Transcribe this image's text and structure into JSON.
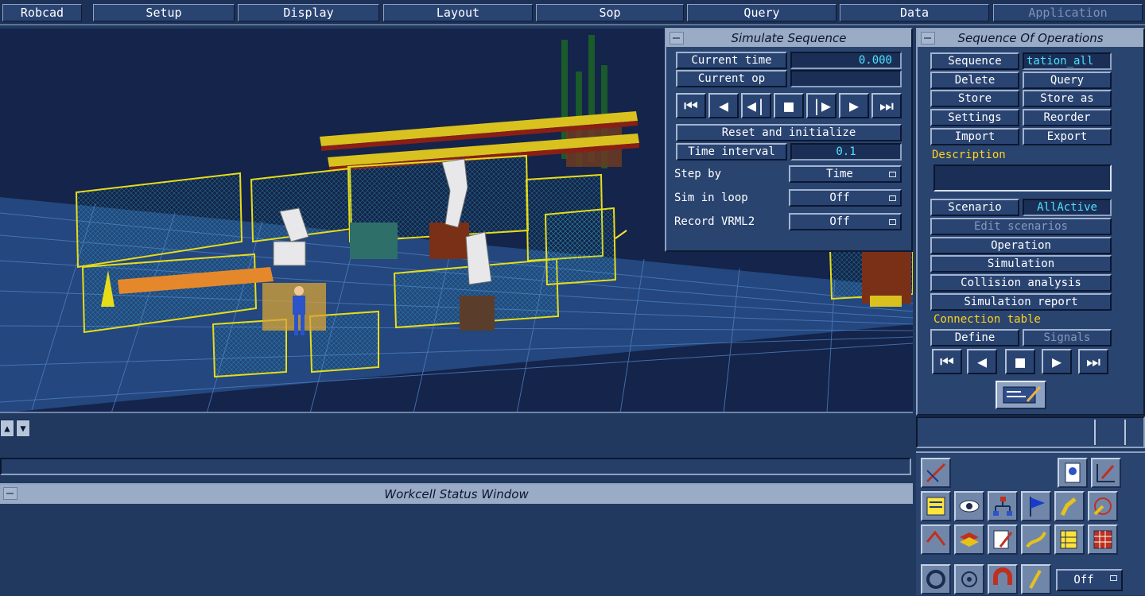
{
  "menu": {
    "robcad": "Robcad",
    "setup": "Setup",
    "display": "Display",
    "layout": "Layout",
    "sop": "Sop",
    "query": "Query",
    "data": "Data",
    "application": "Application"
  },
  "simulate": {
    "title": "Simulate Sequence",
    "current_time_label": "Current time",
    "current_time_value": "0.000",
    "current_op_label": "Current op",
    "current_op_value": "",
    "controls": [
      "⏮",
      "◀",
      "◀|",
      "■",
      "|▶",
      "▶",
      "⏭"
    ],
    "reset_label": "Reset and initialize",
    "time_interval_label": "Time interval",
    "time_interval_value": "0.1",
    "step_by_label": "Step by",
    "step_by_value": "Time",
    "sim_in_loop_label": "Sim in loop",
    "sim_in_loop_value": "Off",
    "record_vrml_label": "Record VRML2",
    "record_vrml_value": "Off"
  },
  "sop": {
    "title": "Sequence Of Operations",
    "sequence_label": "Sequence",
    "sequence_value": "tation_all",
    "delete": "Delete",
    "query": "Query",
    "store": "Store",
    "store_as": "Store as",
    "settings": "Settings",
    "reorder": "Reorder",
    "import": "Import",
    "export": "Export",
    "description_label": "Description",
    "description_value": "",
    "scenario_label": "Scenario",
    "scenario_value": "AllActive",
    "edit_scenarios": "Edit scenarios",
    "operation": "Operation",
    "simulation": "Simulation",
    "collision_analysis": "Collision analysis",
    "simulation_report": "Simulation report",
    "connection_table_label": "Connection table",
    "define": "Define",
    "signals": "Signals",
    "controls": [
      "⏮",
      "◀",
      "■",
      "▶",
      "⏭"
    ]
  },
  "status": {
    "title": "Workcell Status Window"
  },
  "toolbox": {
    "off_label": "Off",
    "icons": [
      "robot-pen-icon",
      "document-icon",
      "grid-pen-icon",
      "list-icon",
      "eye-icon",
      "hierarchy-icon",
      "flag-icon",
      "robot-arm-icon",
      "target-arm-icon",
      "path-icon",
      "layers-icon",
      "chart-pen-icon",
      "paint-icon",
      "table-pen-icon",
      "grid-color-icon",
      "rotate-icon",
      "target-icon",
      "magnet-icon",
      "gripper-icon"
    ]
  },
  "colors": {
    "background": "#21395f",
    "panel": "#2a4470",
    "value_text": "#4ee0ff",
    "section_label": "#ffd21c",
    "fence": "#e6dc1a",
    "floor_grid": "#3d6aa8"
  }
}
